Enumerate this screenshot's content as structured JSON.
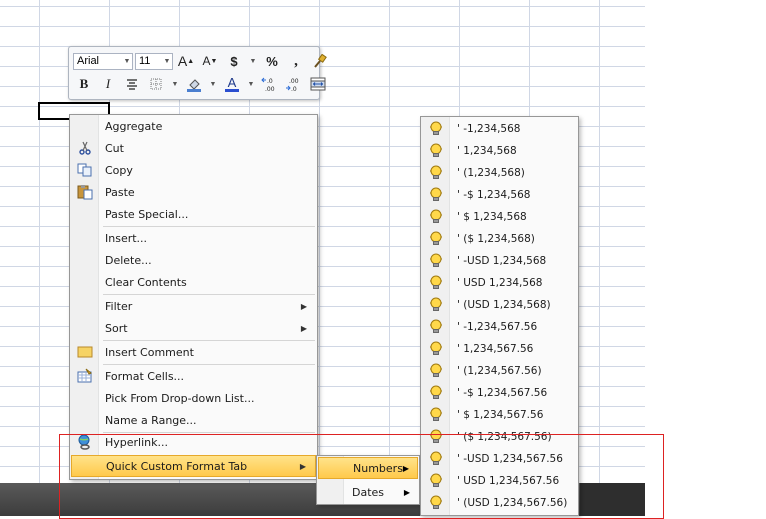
{
  "mini_toolbar": {
    "font_name": "Arial",
    "font_size": "11",
    "buttons": [
      "grow-font",
      "shrink-font",
      "accounting-format",
      "percent-style",
      "comma-style",
      "format-painter",
      "bold",
      "italic",
      "center",
      "borders",
      "fill-color",
      "font-color",
      "increase-decimal",
      "decrease-decimal",
      "merge-center"
    ],
    "labels": {
      "grow": "A",
      "shrink": "A",
      "currency": "$",
      "percent": "%",
      "comma": ",",
      "bold": "B",
      "italic": "I",
      "font_color": "A",
      "inc_dec": ".0 .00",
      "dec_dec": ".00 .0"
    }
  },
  "context_menu": {
    "items": [
      {
        "label": "Aggregate",
        "icon": null
      },
      {
        "label": "Cut",
        "icon": "scissors-icon"
      },
      {
        "label": "Copy",
        "icon": "copy-icon"
      },
      {
        "label": "Paste",
        "icon": "paste-icon"
      },
      {
        "label": "Paste Special...",
        "icon": null
      },
      {
        "label": "Insert...",
        "icon": null
      },
      {
        "label": "Delete...",
        "icon": null
      },
      {
        "label": "Clear Contents",
        "icon": null
      },
      {
        "label": "Filter",
        "icon": null,
        "submenu": true
      },
      {
        "label": "Sort",
        "icon": null,
        "submenu": true
      },
      {
        "label": "Insert Comment",
        "icon": "comment-icon"
      },
      {
        "label": "Format Cells...",
        "icon": "format-cells-icon"
      },
      {
        "label": "Pick From Drop-down List...",
        "icon": null
      },
      {
        "label": "Name a Range...",
        "icon": null
      },
      {
        "label": "Hyperlink...",
        "icon": "hyperlink-icon"
      },
      {
        "label": "Quick Custom Format Tab",
        "icon": null,
        "submenu": true,
        "highlighted": true
      }
    ]
  },
  "submenu": {
    "items": [
      {
        "label": "Numbers",
        "highlighted": true
      },
      {
        "label": "Dates",
        "highlighted": false
      }
    ]
  },
  "numbers_menu": {
    "items": [
      "' -1,234,568",
      "' 1,234,568",
      "' (1,234,568)",
      "' -$ 1,234,568",
      "' $ 1,234,568",
      "' ($ 1,234,568)",
      "' -USD 1,234,568",
      "' USD 1,234,568",
      "' (USD 1,234,568)",
      "' -1,234,567.56",
      "' 1,234,567.56",
      "' (1,234,567.56)",
      "' -$ 1,234,567.56",
      "' $ 1,234,567.56",
      "' ($ 1,234,567.56)",
      "' -USD 1,234,567.56",
      "' USD 1,234,567.56",
      "' (USD 1,234,567.56)"
    ]
  },
  "colors": {
    "highlight": "#ffc94b",
    "grid": "#d0d7e5",
    "annotation": "#dd2222"
  }
}
